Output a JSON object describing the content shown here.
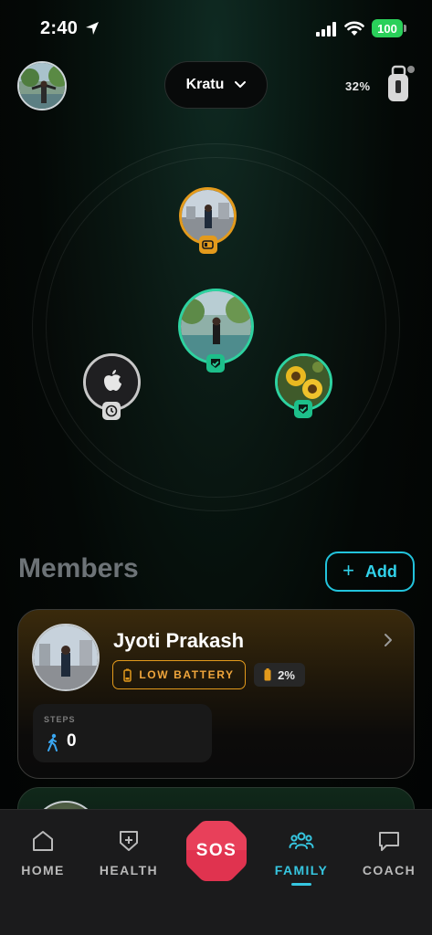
{
  "status_bar": {
    "time": "2:40",
    "battery": "100"
  },
  "header": {
    "selected_person": "Kratu",
    "device_battery": "32%"
  },
  "members": {
    "title": "Members",
    "add_label": "Add",
    "cards": [
      {
        "name": "Jyoti Prakash",
        "status_badge": "LOW BATTERY",
        "battery_percent": "2%",
        "steps_label": "STEPS",
        "steps_value": "0"
      }
    ]
  },
  "nav": {
    "items": [
      {
        "label": "HOME",
        "icon": "home-icon"
      },
      {
        "label": "HEALTH",
        "icon": "health-shield-icon"
      },
      {
        "label": "SOS",
        "icon": "sos-octagon-icon"
      },
      {
        "label": "FAMILY",
        "icon": "family-icon"
      },
      {
        "label": "COACH",
        "icon": "chat-bubble-icon"
      }
    ],
    "active": "FAMILY"
  },
  "colors": {
    "accent": "#36c6e0",
    "warning": "#e39a1c",
    "safe": "#2ed2a0",
    "sos": "#e0334f",
    "battery_full": "#2ad05a"
  }
}
